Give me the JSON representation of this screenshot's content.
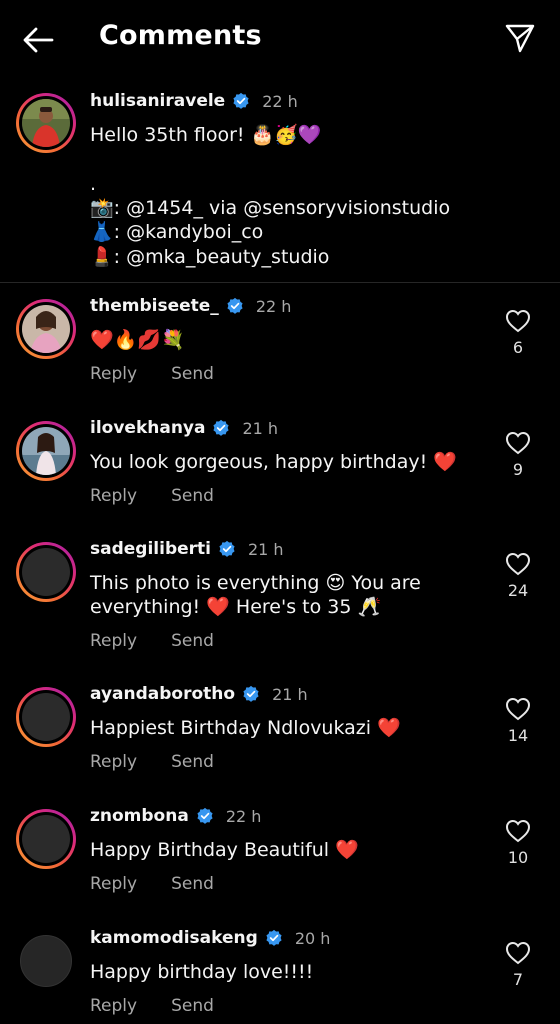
{
  "header": {
    "title": "Comments"
  },
  "caption": {
    "username": "hulisaniravele",
    "time": "22 h",
    "lines": [
      "Hello 35th floor! 🎂🥳💜",
      "",
      ".",
      "📸: @1454_ via @sensoryvisionstudio",
      "👗: @kandyboi_co",
      "💄: @mka_beauty_studio"
    ]
  },
  "comments": [
    {
      "username": "thembiseete_",
      "time": "22 h",
      "text": "❤️🔥💋💐",
      "likes": "6",
      "reply": "Reply",
      "send": "Send"
    },
    {
      "username": "ilovekhanya",
      "time": "21 h",
      "text": "You look gorgeous, happy birthday! ❤️",
      "likes": "9",
      "reply": "Reply",
      "send": "Send"
    },
    {
      "username": "sadegiliberti",
      "time": "21 h",
      "text_line1": "This photo is everything 😍 You are",
      "text_line2": "everything! ❤️ Here's to 35 🥂",
      "likes": "24",
      "reply": "Reply",
      "send": "Send"
    },
    {
      "username": "ayandaborotho",
      "time": "21 h",
      "text": "Happiest Birthday Ndlovukazi ❤️",
      "likes": "14",
      "reply": "Reply",
      "send": "Send"
    },
    {
      "username": "znombona",
      "time": "22 h",
      "text": "Happy Birthday Beautiful ❤️",
      "likes": "10",
      "reply": "Reply",
      "send": "Send"
    },
    {
      "username": "kamomodisakeng",
      "time": "20 h",
      "text": "Happy birthday love!!!!",
      "likes": "7",
      "reply": "Reply",
      "send": "Send"
    }
  ],
  "icons": {
    "back": "arrow-left-icon",
    "share": "paper-plane-icon",
    "verified": "verified-badge-icon",
    "like": "heart-outline-icon"
  },
  "colors": {
    "background": "#000000",
    "verified": "#3897f0",
    "secondary_text": "#a8a8a8"
  }
}
